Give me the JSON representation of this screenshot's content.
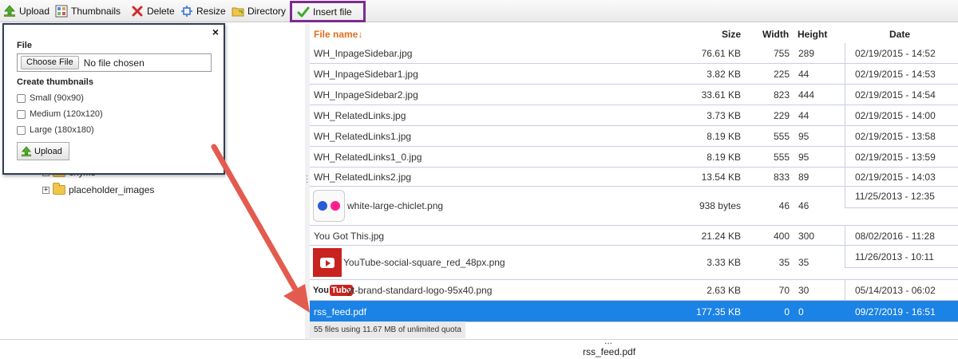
{
  "toolbar": {
    "upload": "Upload",
    "thumbnails": "Thumbnails",
    "delete": "Delete",
    "resize": "Resize",
    "directory": "Directory",
    "insert_file": "Insert file",
    "icons": [
      "upload-icon",
      "thumbnails-icon",
      "delete-icon",
      "resize-icon",
      "directory-icon",
      "checkmark-icon"
    ]
  },
  "tree": {
    "partial_folder": "oxy...s",
    "placeholder_folder": "placeholder_images"
  },
  "upload_popup": {
    "file_label": "File",
    "choose_file": "Choose File",
    "no_file": "No file chosen",
    "create_thumbnails": "Create thumbnails",
    "small": "Small (90x90)",
    "medium": "Medium (120x120)",
    "large": "Large (180x180)",
    "upload_button": "Upload",
    "close": "×"
  },
  "columns": {
    "name": "File name↓",
    "size": "Size",
    "width": "Width",
    "height": "Height",
    "date": "Date"
  },
  "files": [
    {
      "name": "WH_InpageSidebar.jpg",
      "size": "76.61 KB",
      "width": "755",
      "height": "289",
      "date": "02/19/2015 - 14:52"
    },
    {
      "name": "WH_InpageSidebar1.jpg",
      "size": "3.82 KB",
      "width": "225",
      "height": "44",
      "date": "02/19/2015 - 14:53"
    },
    {
      "name": "WH_InpageSidebar2.jpg",
      "size": "33.61 KB",
      "width": "823",
      "height": "444",
      "date": "02/19/2015 - 14:54"
    },
    {
      "name": "WH_RelatedLinks.jpg",
      "size": "3.73 KB",
      "width": "229",
      "height": "44",
      "date": "02/19/2015 - 14:00"
    },
    {
      "name": "WH_RelatedLinks1.jpg",
      "size": "8.19 KB",
      "width": "555",
      "height": "95",
      "date": "02/19/2015 - 13:58"
    },
    {
      "name": "WH_RelatedLinks1_0.jpg",
      "size": "8.19 KB",
      "width": "555",
      "height": "95",
      "date": "02/19/2015 - 13:59"
    },
    {
      "name": "WH_RelatedLinks2.jpg",
      "size": "13.54 KB",
      "width": "833",
      "height": "89",
      "date": "02/19/2015 - 14:03"
    },
    {
      "name": "white-large-chiclet.png",
      "size": "938 bytes",
      "width": "46",
      "height": "46",
      "date": "11/25/2013 - 12:35"
    },
    {
      "name": "You Got This.jpg",
      "size": "21.24 KB",
      "width": "400",
      "height": "300",
      "date": "08/02/2016 - 11:28"
    },
    {
      "name": "YouTube-social-square_red_48px.png",
      "size": "3.33 KB",
      "width": "35",
      "height": "35",
      "date": "11/26/2013 - 10:11"
    },
    {
      "name": "yt-brand-standard-logo-95x40.png",
      "size": "2.63 KB",
      "width": "70",
      "height": "30",
      "date": "05/14/2013 - 06:02"
    },
    {
      "name": "rss_feed.pdf",
      "size": "177.35 KB",
      "width": "0",
      "height": "0",
      "date": "09/27/2019 - 16:51"
    }
  ],
  "quota": "55 files using 11.67 MB of unlimited quota",
  "status": {
    "dots": "...",
    "selected_file": "rss_feed.pdf"
  },
  "colors": {
    "selection": "#1b82e6",
    "highlight_border": "#7b2c8f",
    "annotation_arrow": "#e35b4e",
    "sort_header": "#e07020"
  }
}
